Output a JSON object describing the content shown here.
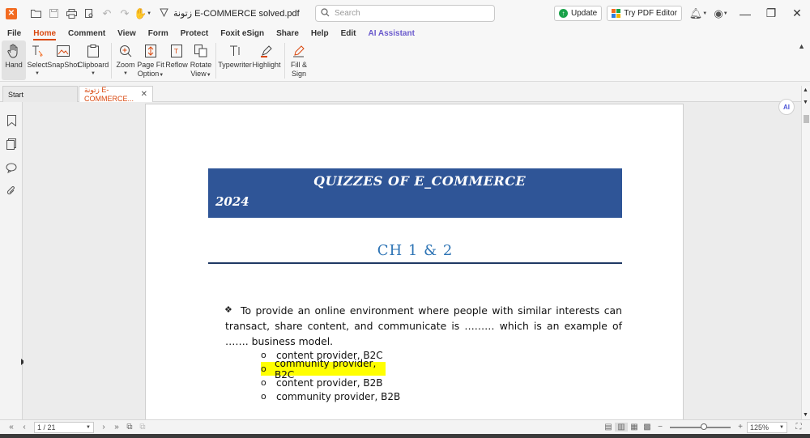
{
  "title_bar": {
    "document_title": "زتونة E-COMMERCE solved.pdf",
    "search_placeholder": "Search",
    "update_label": "Update",
    "try_pdf_editor_label": "Try PDF Editor"
  },
  "menu": {
    "tabs": [
      "File",
      "Home",
      "Comment",
      "View",
      "Form",
      "Protect",
      "Foxit eSign",
      "Share",
      "Help",
      "Edit",
      "AI Assistant"
    ],
    "active": "Home"
  },
  "ribbon": {
    "hand": "Hand",
    "select": "Select",
    "snapshot": "SnapShot",
    "clipboard": "Clipboard",
    "zoom": "Zoom",
    "page_fit_line1": "Page Fit",
    "page_fit_line2": "Option",
    "reflow": "Reflow",
    "rotate_line1": "Rotate",
    "rotate_line2": "View",
    "typewriter": "Typewriter",
    "highlight": "Highlight",
    "fill_sign_line1": "Fill &",
    "fill_sign_line2": "Sign"
  },
  "doc_tabs": {
    "start": "Start",
    "current": "زتونة E-COMMERCE..."
  },
  "document": {
    "banner_title": "QUIZZES OF E_COMMERCE",
    "banner_year": "2024",
    "chapter": "CH 1 & 2",
    "question": "To provide an online environment where people with similar interests can transact, share content, and communicate is ……… which is an example of ……. business model.",
    "options": [
      "content provider, B2C",
      "community provider, B2C",
      "content provider, B2B",
      "community provider, B2B"
    ],
    "highlighted_option_index": 1
  },
  "status_bar": {
    "page_indicator": "1 / 21",
    "zoom": "125%"
  },
  "colors": {
    "accent": "#d9480f",
    "banner": "#2f5597",
    "chapter": "#2e74b5",
    "highlight": "#ffff00"
  }
}
